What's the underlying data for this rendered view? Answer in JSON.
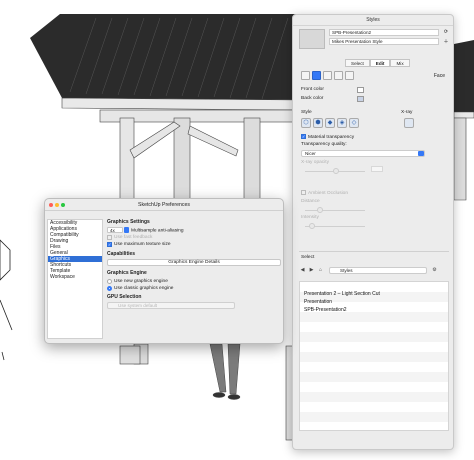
{
  "styles_panel": {
    "window_title": "Styles",
    "style_name": "SPB-Presentation2",
    "style_description": "Mikes Presentation Style",
    "tabs": [
      "Select",
      "Edit",
      "Mix"
    ],
    "active_tab": "Edit",
    "face_label": "Face",
    "front_color_label": "Front color",
    "back_color_label": "Back color",
    "front_color": "#ffffff",
    "back_color": "#c9d3e6",
    "style_label": "Style",
    "xray_label": "X-ray",
    "material_transparency_label": "Material transparency",
    "transparency_quality_label": "Transparency quality:",
    "transparency_quality_value": "Nicer",
    "xray_opacity_label": "X-ray opacity",
    "ambient_occlusion_label": "Ambient Occlusion",
    "distance_label": "Distance",
    "intensity_label": "Intensity",
    "select_header": "Select",
    "library_value": "Styles",
    "library_items": [
      "Presentation 2 – Light Section Cut",
      "Presentation",
      "SPB-Presentation2"
    ]
  },
  "prefs": {
    "window_title": "SketchUp Preferences",
    "sidebar_items": [
      "Accessibility",
      "Applications",
      "Compatibility",
      "Drawing",
      "Files",
      "General",
      "Graphics",
      "Shortcuts",
      "Template",
      "Workspace"
    ],
    "selected_item": "Graphics",
    "graphics_settings_header": "Graphics Settings",
    "multisample_value": "4x",
    "multisample_label": "Multisample anti-aliasing",
    "fast_feedback_label": "Use fast feedback",
    "max_texture_label": "Use maximum texture size",
    "capabilities_header": "Capabilities",
    "engine_details_button": "Graphics Engine Details",
    "graphics_engine_header": "Graphics Engine",
    "new_engine_label": "Use new graphics engine",
    "classic_engine_label": "Use classic graphics engine",
    "gpu_header": "GPU Selection",
    "gpu_value": "Use system default"
  },
  "colors": {
    "accent": "#3478f6",
    "roof": "#2e2e2e",
    "wood": "#e4e4e4"
  }
}
